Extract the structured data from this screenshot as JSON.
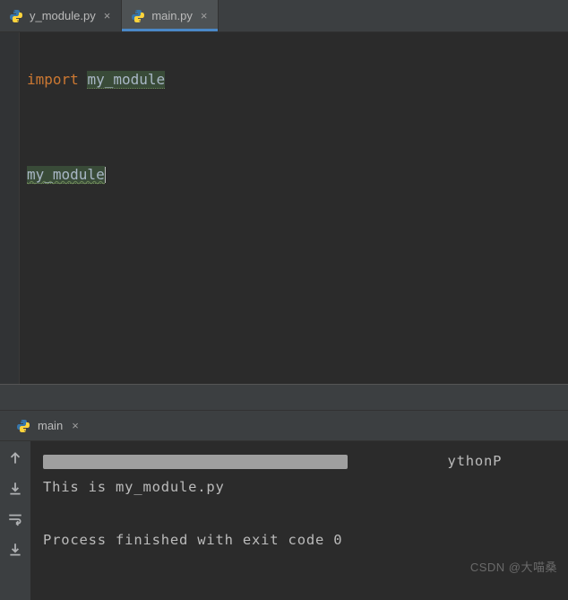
{
  "tabs": [
    {
      "label": "y_module.py",
      "active": false
    },
    {
      "label": "main.py",
      "active": true
    }
  ],
  "code": {
    "line1_kw": "import",
    "line1_ident": "my_module",
    "line3_ident": "my_module"
  },
  "run": {
    "tab_label": "main",
    "path_fragment": "ythonP",
    "output_line": "This is my_module.py",
    "exit_line": "Process finished with exit code 0"
  },
  "watermark": "CSDN @大喵桑"
}
